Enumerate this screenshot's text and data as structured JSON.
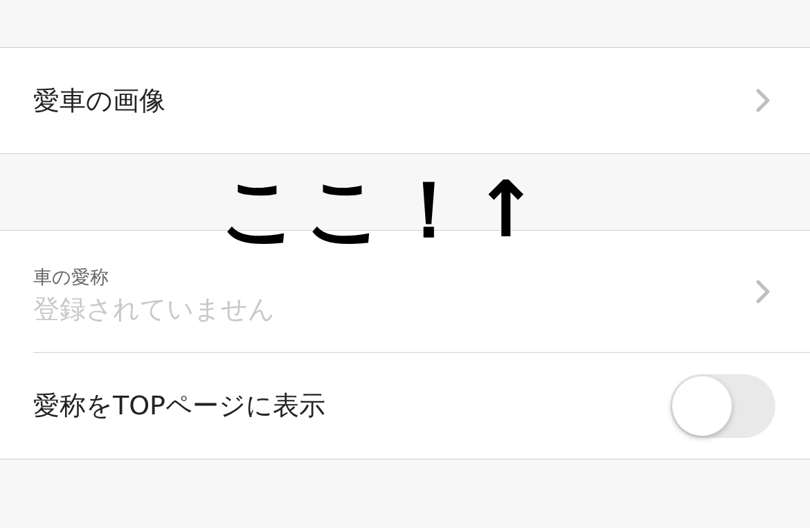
{
  "sections": [
    {
      "rows": [
        {
          "kind": "link",
          "label": "愛車の画像"
        }
      ]
    },
    {
      "rows": [
        {
          "kind": "field",
          "label": "車の愛称",
          "placeholder": "登録されていません"
        },
        {
          "kind": "toggle",
          "label": "愛称をTOPページに表示",
          "on": false
        }
      ]
    }
  ],
  "annotation": "ここ！↑"
}
